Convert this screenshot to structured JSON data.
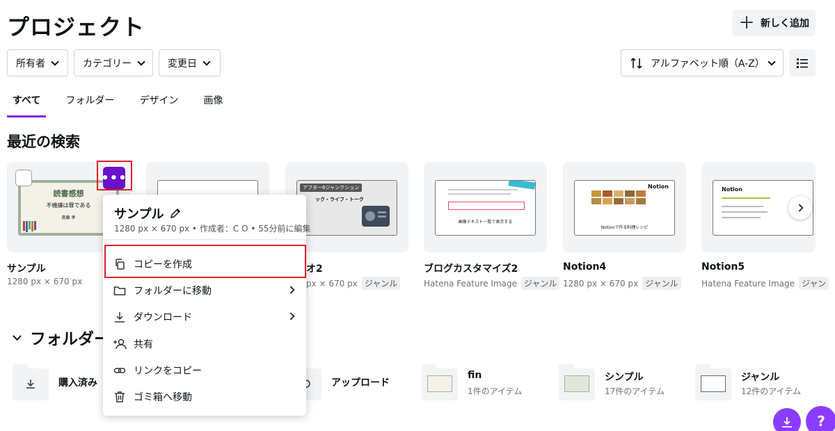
{
  "header": {
    "title": "プロジェクト",
    "add_label": "新しく追加"
  },
  "filters": [
    {
      "label": "所有者"
    },
    {
      "label": "カテゴリー"
    },
    {
      "label": "変更日"
    }
  ],
  "sort": {
    "label": "アルファベット順（A-Z）"
  },
  "tabs": [
    {
      "label": "すべて",
      "active": true
    },
    {
      "label": "フォルダー",
      "active": false
    },
    {
      "label": "デザイン",
      "active": false
    },
    {
      "label": "画像",
      "active": false
    }
  ],
  "recent": {
    "title": "最近の検索",
    "cards": [
      {
        "name": "サンプル",
        "meta": "1280 px × 670 px",
        "tag": "",
        "thumb_title": "読書感想",
        "thumb_sub": "不機嫌は罪である",
        "thumb_author": "斎藤 孝"
      },
      {
        "name": "",
        "meta": "",
        "tag": ""
      },
      {
        "name": "オ2",
        "meta": "px × 670 px",
        "tag": "ジャンル",
        "thumb_title": "アフター6ジャンクション",
        "thumb_sub": "ック・ライフ・トーク"
      },
      {
        "name": "ブログカスタマイズ2",
        "meta": "Hatena Feature Image",
        "tag": "ジャンル",
        "thumb_sub": "画像テキスト一覧で表示する"
      },
      {
        "name": "Notion4",
        "meta": "1280 px × 670 px",
        "tag": "ジャンル",
        "thumb_title": "Notion",
        "thumb_sub": "Notionで作る料理レシピ"
      },
      {
        "name": "Notion5",
        "meta": "Hatena Feature Image",
        "tag": "ジャン",
        "thumb_title": "Notion"
      }
    ]
  },
  "folders_section": {
    "title": "フォルダー"
  },
  "folders": [
    {
      "name": "購入済み",
      "count": ""
    },
    {
      "name": "アップロード",
      "count": ""
    },
    {
      "name": "fin",
      "count": "1件のアイテム"
    },
    {
      "name": "シンプル",
      "count": "17件のアイテム"
    },
    {
      "name": "ジャンル",
      "count": "12件のアイテム"
    }
  ],
  "context_menu": {
    "title": "サンプル",
    "subtitle": "1280 px × 670 px • 作成者：C O • 55分前に編集",
    "items": [
      {
        "label": "コピーを作成",
        "icon": "copy-icon"
      },
      {
        "label": "フォルダーに移動",
        "icon": "folder-icon"
      },
      {
        "label": "ダウンロード",
        "icon": "download-icon"
      },
      {
        "label": "共有",
        "icon": "share-icon"
      },
      {
        "label": "リンクをコピー",
        "icon": "link-icon"
      },
      {
        "label": "ゴミ箱へ移動",
        "icon": "trash-icon"
      }
    ]
  },
  "fabs": {
    "help_label": "?"
  },
  "colors": {
    "accent": "#7d2ae8",
    "more_button": "#6b11cc",
    "highlight": "#e01f26",
    "fab": "#8b3dff"
  }
}
